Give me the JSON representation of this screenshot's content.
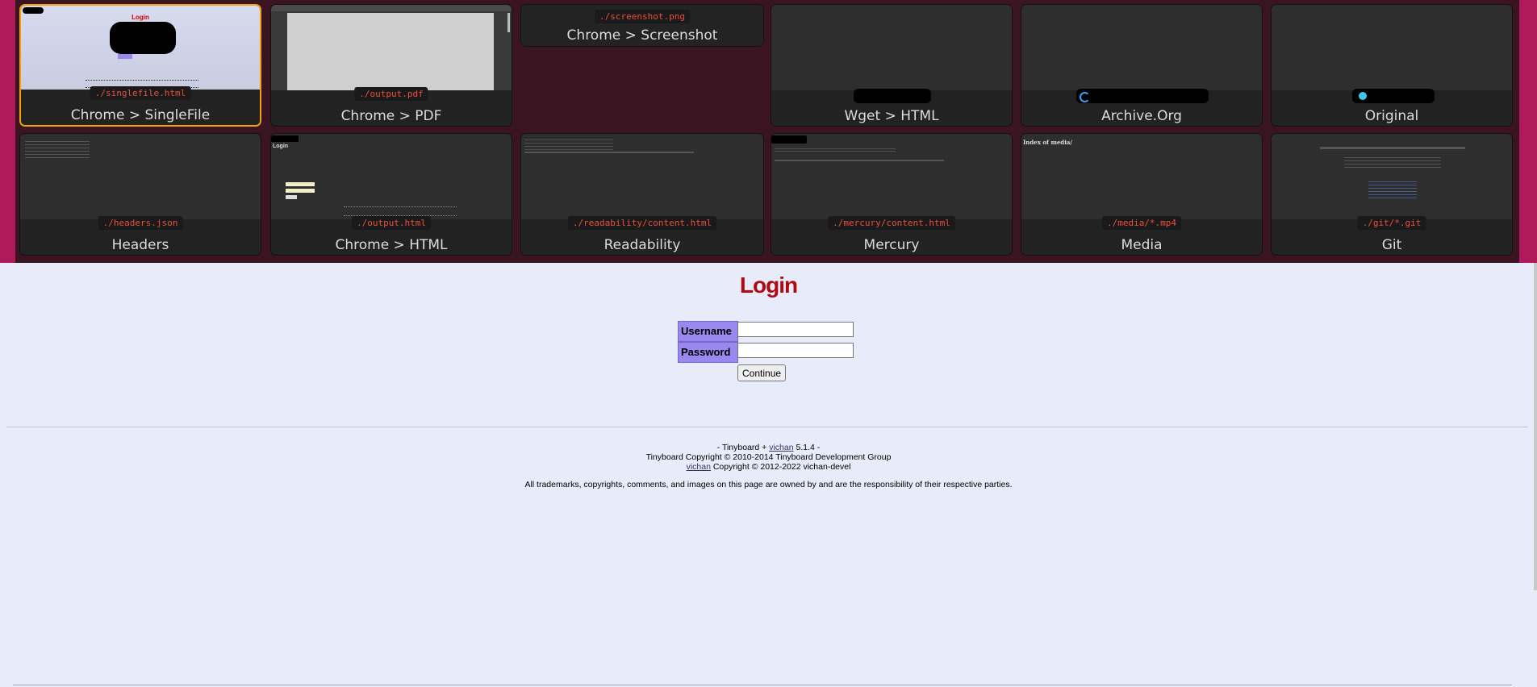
{
  "archive": {
    "cards": [
      {
        "path": "./singlefile.html",
        "label": "Chrome > SingleFile",
        "active": true
      },
      {
        "path": "./output.pdf",
        "label": "Chrome > PDF"
      },
      {
        "path": "./screenshot.png",
        "label": "Chrome > Screenshot"
      },
      {
        "path": "",
        "label": "Wget > HTML"
      },
      {
        "path": "",
        "label": "Archive.Org"
      },
      {
        "path": "",
        "label": "Original"
      },
      {
        "path": "./headers.json",
        "label": "Headers"
      },
      {
        "path": "./output.html",
        "label": "Chrome > HTML"
      },
      {
        "path": "./readability/content.html",
        "label": "Readability"
      },
      {
        "path": "./mercury/content.html",
        "label": "Mercury"
      },
      {
        "path": "./media/*.mp4",
        "label": "Media"
      },
      {
        "path": "./git/*.git",
        "label": "Git"
      }
    ],
    "thumb_text": {
      "singlefile_title": "Login",
      "chrome_html_title": "Login",
      "media_title": "Index of media/"
    }
  },
  "page": {
    "title": "Login",
    "username_label": "Username",
    "password_label": "Password",
    "username_value": "",
    "password_value": "",
    "continue_label": "Continue"
  },
  "footer": {
    "line1_prefix": "- Tinyboard + ",
    "line1_link": "vichan",
    "line1_suffix": " 5.1.4 -",
    "line2": "Tinyboard Copyright © 2010-2014 Tinyboard Development Group",
    "line3_link": "vichan",
    "line3_suffix": " Copyright © 2012-2022 vichan-devel",
    "legal": "All trademarks, copyrights, comments, and images on this page are owned by and are the responsibility of their respective parties."
  },
  "colors": {
    "accent_border": "#b0195a",
    "active_card": "#f3a20d",
    "title_red": "#af0a0f",
    "label_bg": "#9988ee"
  }
}
